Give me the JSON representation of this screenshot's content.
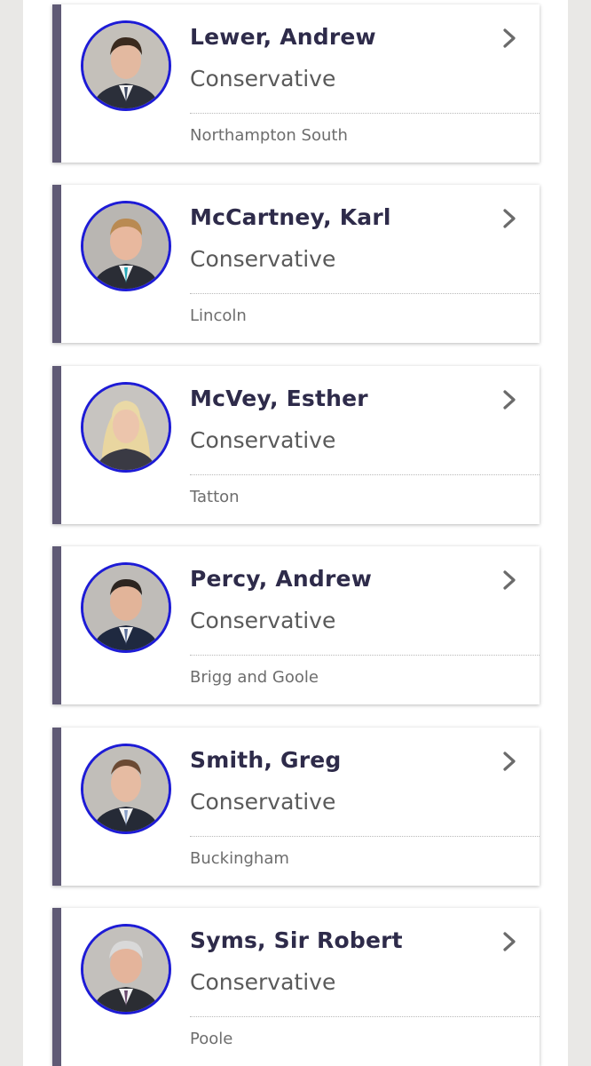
{
  "members": [
    {
      "name": "Lewer, Andrew",
      "party": "Conservative",
      "constituency": "Northampton South",
      "icon": "chevron-right-icon"
    },
    {
      "name": "McCartney, Karl",
      "party": "Conservative",
      "constituency": "Lincoln",
      "icon": "chevron-right-icon"
    },
    {
      "name": "McVey, Esther",
      "party": "Conservative",
      "constituency": "Tatton",
      "icon": "chevron-right-icon"
    },
    {
      "name": "Percy, Andrew",
      "party": "Conservative",
      "constituency": "Brigg and Goole",
      "icon": "chevron-right-icon"
    },
    {
      "name": "Smith, Greg",
      "party": "Conservative",
      "constituency": "Buckingham",
      "icon": "chevron-right-icon"
    },
    {
      "name": "Syms, Sir Robert",
      "party": "Conservative",
      "constituency": "Poole",
      "icon": "chevron-right-icon"
    }
  ],
  "colors": {
    "party_bar": "#5f5a75",
    "avatar_ring": "#1d1bd6",
    "name_text": "#2e2b4a",
    "page_background": "#e9e8e6"
  }
}
